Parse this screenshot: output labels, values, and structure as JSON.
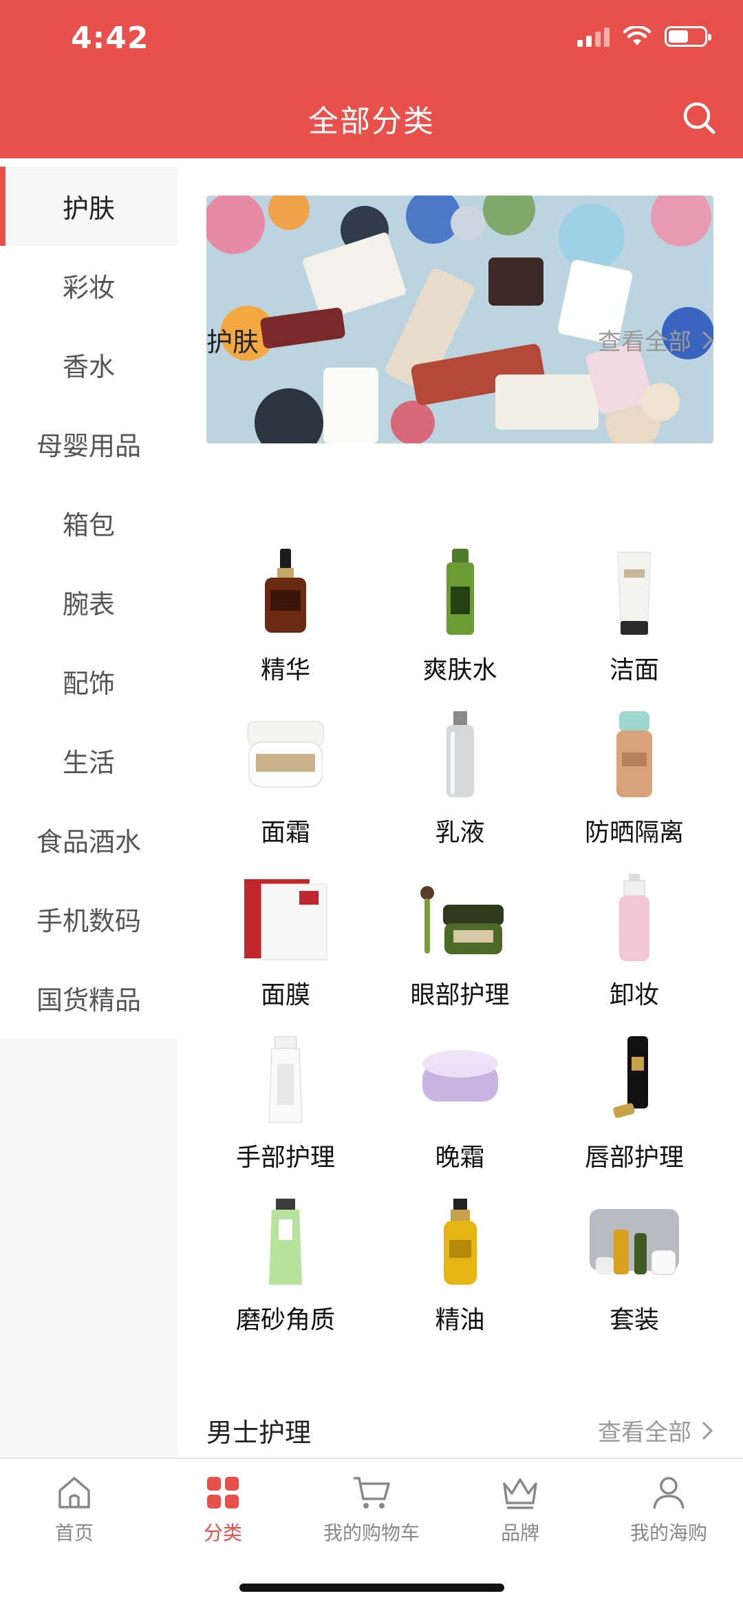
{
  "status_bar": {
    "time": "4:42"
  },
  "header": {
    "title": "全部分类",
    "search_icon": "search-icon"
  },
  "sidebar": {
    "items": [
      {
        "label": "护肤",
        "active": true
      },
      {
        "label": "彩妆"
      },
      {
        "label": "香水"
      },
      {
        "label": "母婴用品"
      },
      {
        "label": "箱包"
      },
      {
        "label": "腕表"
      },
      {
        "label": "配饰"
      },
      {
        "label": "生活"
      },
      {
        "label": "食品酒水"
      },
      {
        "label": "手机数码"
      },
      {
        "label": "国货精品"
      }
    ]
  },
  "main": {
    "sections": [
      {
        "title": "护肤",
        "view_all": "查看全部",
        "items": [
          {
            "label": "精华",
            "icon": "serum-bottle-icon"
          },
          {
            "label": "爽肤水",
            "icon": "toner-bottle-icon"
          },
          {
            "label": "洁面",
            "icon": "cleanser-tube-icon"
          },
          {
            "label": "面霜",
            "icon": "cream-jar-icon"
          },
          {
            "label": "乳液",
            "icon": "lotion-bottle-icon"
          },
          {
            "label": "防晒隔离",
            "icon": "sunscreen-bottle-icon"
          },
          {
            "label": "面膜",
            "icon": "face-mask-icon"
          },
          {
            "label": "眼部护理",
            "icon": "eye-cream-icon"
          },
          {
            "label": "卸妆",
            "icon": "cleansing-oil-icon"
          },
          {
            "label": "手部护理",
            "icon": "hand-cream-icon"
          },
          {
            "label": "晚霜",
            "icon": "night-cream-icon"
          },
          {
            "label": "唇部护理",
            "icon": "lip-care-icon"
          },
          {
            "label": "磨砂角质",
            "icon": "scrub-tube-icon"
          },
          {
            "label": "精油",
            "icon": "oil-bottle-icon"
          },
          {
            "label": "套装",
            "icon": "gift-set-icon"
          }
        ]
      },
      {
        "title": "男士护理",
        "view_all": "查看全部"
      }
    ]
  },
  "tabbar": {
    "items": [
      {
        "label": "首页",
        "icon": "home-icon"
      },
      {
        "label": "分类",
        "icon": "category-icon",
        "active": true
      },
      {
        "label": "我的购物车",
        "icon": "cart-icon"
      },
      {
        "label": "品牌",
        "icon": "crown-icon"
      },
      {
        "label": "我的海购",
        "icon": "user-icon"
      }
    ]
  },
  "colors": {
    "accent": "#e8504b",
    "muted": "#888888",
    "sidebar_bg": "#f6f6f6"
  }
}
